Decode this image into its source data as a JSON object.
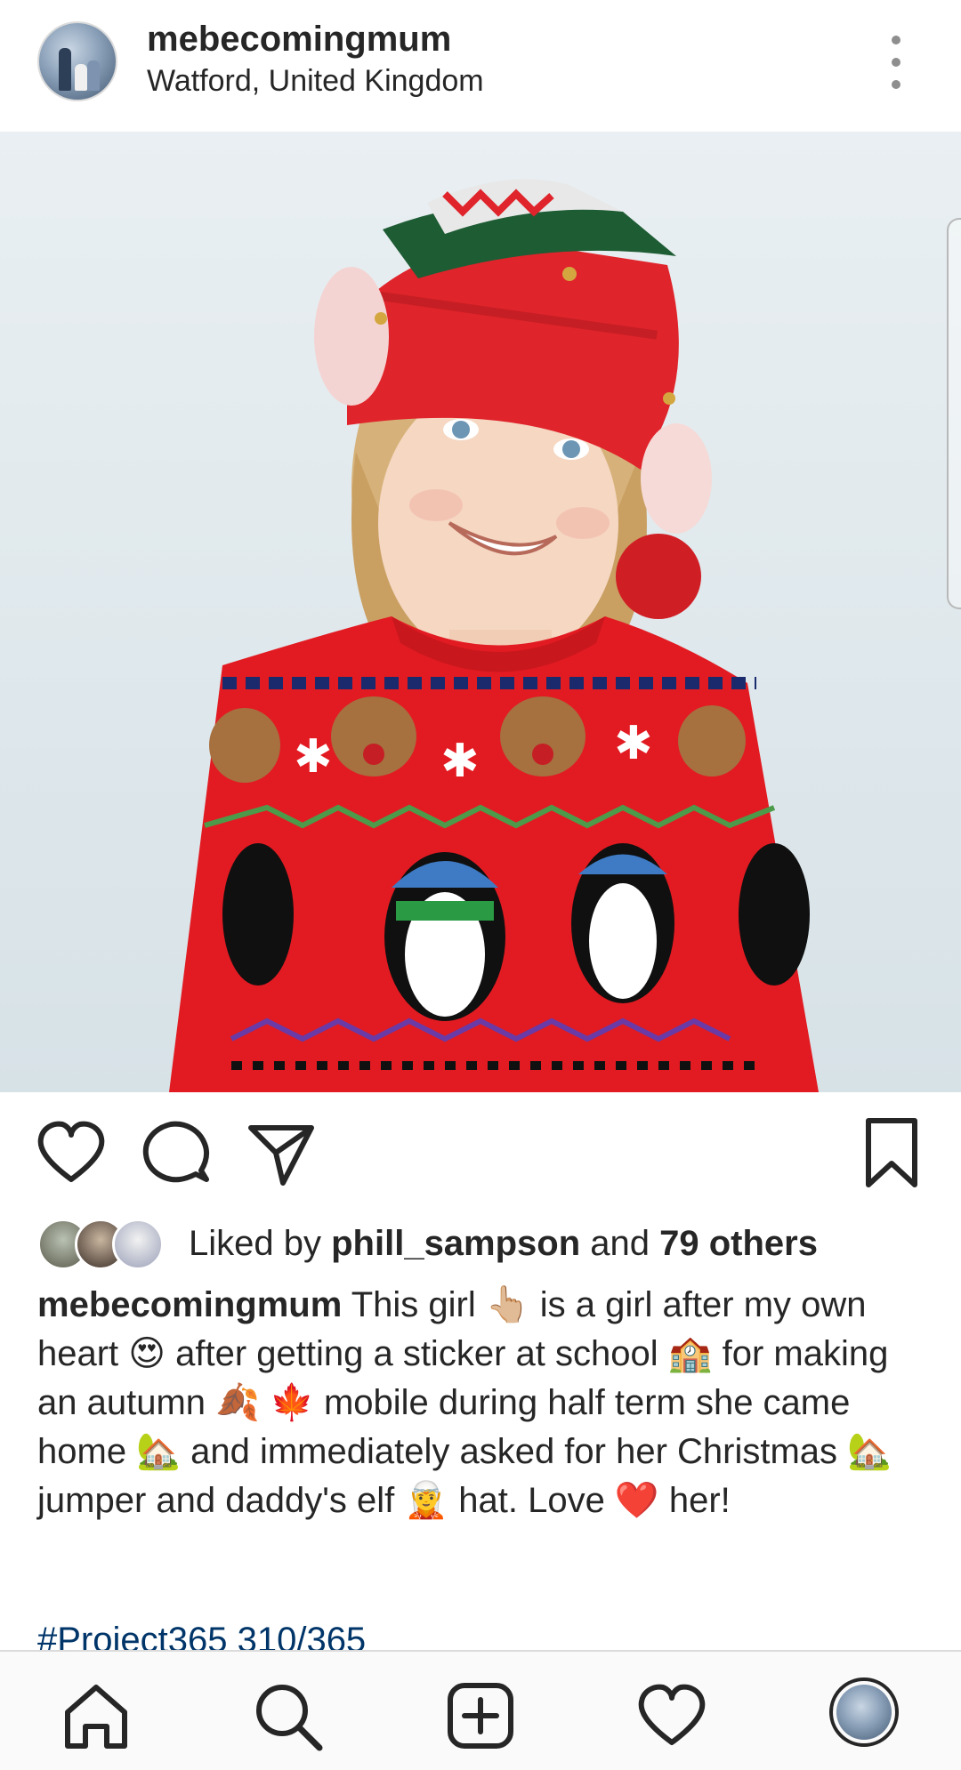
{
  "post": {
    "username": "mebecomingmum",
    "location": "Watford, United Kingdom",
    "photo_alt_icon": "photo"
  },
  "likes": {
    "prefix": "Liked by ",
    "first_user": "phill_sampson",
    "middle": " and ",
    "others": "79 others"
  },
  "caption": {
    "username": "mebecomingmum",
    "text": " This girl 👆🏼 is a girl after my own heart 😍 after getting a sticker at school 🏫 for making an autumn 🍂 🍁 mobile during half term she came home 🏡 and immediately asked for her Christmas 🏡 jumper and daddy's elf 🧝 hat. Love ❤️ her!",
    "hashtags": "#Project365 310/365"
  },
  "icons": {
    "like": "heart-icon",
    "comment": "comment-icon",
    "share": "paper-plane-icon",
    "save": "bookmark-icon",
    "more": "more-vertical-icon"
  },
  "bottom_nav": [
    "home-icon",
    "search-icon",
    "new-post-icon",
    "activity-icon",
    "profile-icon"
  ],
  "colors": {
    "text": "#262626",
    "hashtag": "#003569",
    "divider": "#dbdbdb",
    "nav_bg": "#fafafa",
    "sweater_red": "#e21b22",
    "hat_green": "#1e5c34"
  }
}
